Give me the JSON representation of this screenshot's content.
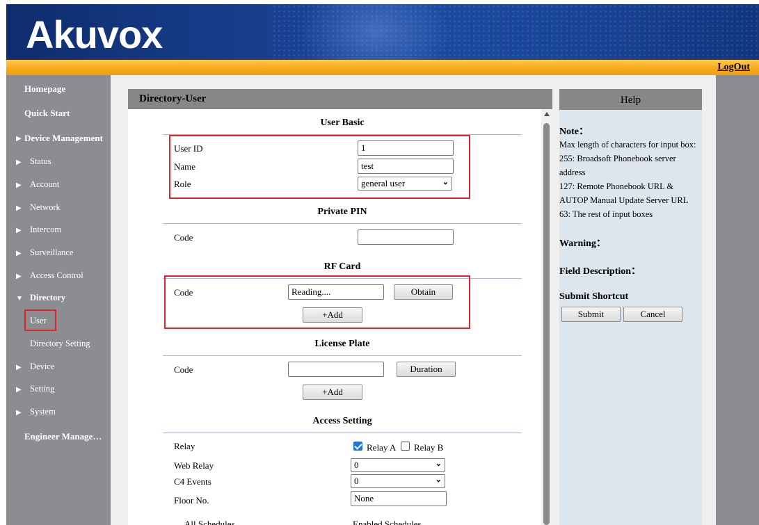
{
  "brand": {
    "logo_text": "Akuvox"
  },
  "topbar": {
    "logout_label": "LogOut"
  },
  "sidebar": {
    "items": [
      {
        "label": "Homepage",
        "level": "top"
      },
      {
        "label": "Quick Start",
        "level": "top"
      },
      {
        "label": "Device Management",
        "level": "top",
        "arrow": "▶"
      },
      {
        "label": "Status",
        "arrow": "▶"
      },
      {
        "label": "Account",
        "arrow": "▶"
      },
      {
        "label": "Network",
        "arrow": "▶"
      },
      {
        "label": "Intercom",
        "arrow": "▶"
      },
      {
        "label": "Surveillance",
        "arrow": "▶"
      },
      {
        "label": "Access Control",
        "arrow": "▶"
      },
      {
        "label": "Directory",
        "arrow": "▼"
      },
      {
        "label": "User"
      },
      {
        "label": "Directory Setting"
      },
      {
        "label": "Device",
        "arrow": "▶"
      },
      {
        "label": "Setting",
        "arrow": "▶"
      },
      {
        "label": "System",
        "arrow": "▶"
      },
      {
        "label": "Engineer Manage…",
        "level": "top"
      }
    ]
  },
  "panel": {
    "title": "Directory-User",
    "user_basic": {
      "title": "User Basic",
      "user_id_label": "User ID",
      "user_id_value": "1",
      "name_label": "Name",
      "name_value": "test",
      "role_label": "Role",
      "role_value": "general user"
    },
    "private_pin": {
      "title": "Private PIN",
      "code_label": "Code",
      "code_value": ""
    },
    "rf_card": {
      "title": "RF Card",
      "code_label": "Code",
      "code_value": "Reading....",
      "obtain_label": "Obtain",
      "add_label": "+Add"
    },
    "license_plate": {
      "title": "License Plate",
      "code_label": "Code",
      "code_value": "",
      "duration_label": "Duration",
      "add_label": "+Add"
    },
    "access_setting": {
      "title": "Access Setting",
      "relay_label": "Relay",
      "relay_a_label": "Relay A",
      "relay_a_checked": true,
      "relay_b_label": "Relay B",
      "relay_b_checked": false,
      "web_relay_label": "Web Relay",
      "web_relay_value": "0",
      "c4_events_label": "C4 Events",
      "c4_events_value": "0",
      "floor_label": "Floor No.",
      "floor_value": "None",
      "all_schedules_label": "All Schedules",
      "enabled_schedules_label": "Enabled Schedules"
    }
  },
  "help": {
    "title": "Help",
    "note_heading": "Note：",
    "note_lines": [
      "Max length of characters for input box:",
      "255: Broadsoft Phonebook server address",
      "127: Remote Phonebook URL & AUTOP Manual Update Server URL",
      "63: The rest of input boxes"
    ],
    "warning_heading": "Warning：",
    "field_desc_heading": "Field Description：",
    "submit_shortcut_heading": "Submit Shortcut",
    "submit_label": "Submit",
    "cancel_label": "Cancel"
  },
  "colors": {
    "accent_orange": "#f6a91a",
    "banner_blue": "#173d8a",
    "highlight_red": "#e0242b",
    "sidebar_gray": "#8c8d90"
  }
}
